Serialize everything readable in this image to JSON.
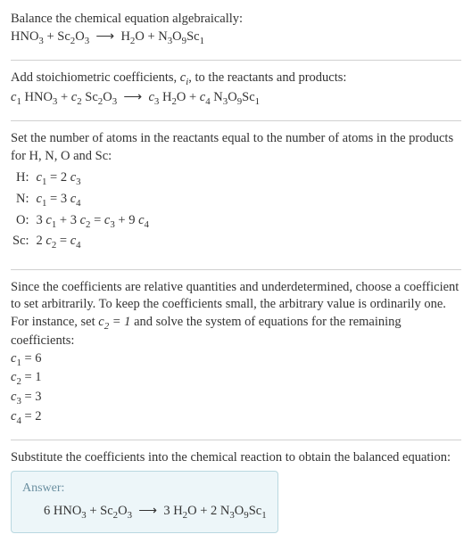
{
  "header": {
    "line1": "Balance the chemical equation algebraically:",
    "chem_eq": "HNO₃ + Sc₂O₃ ⟶ H₂O + N₃O₉Sc₁"
  },
  "step1": {
    "intro_a": "Add stoichiometric coefficients, ",
    "intro_ci": "cᵢ",
    "intro_b": ", to the reactants and products:",
    "chem_eq_a": "c₁ HNO₃ + c₂ Sc₂O₃ ⟶ c₃ H₂O + c₄ N₃O₉Sc₁"
  },
  "step2": {
    "intro": "Set the number of atoms in the reactants equal to the number of atoms in the products for H, N, O and Sc:",
    "rows": [
      {
        "lab": "H:",
        "eq": "c₁ = 2 c₃"
      },
      {
        "lab": "N:",
        "eq": "c₁ = 3 c₄"
      },
      {
        "lab": "O:",
        "eq": "3 c₁ + 3 c₂ = c₃ + 9 c₄"
      },
      {
        "lab": "Sc:",
        "eq": "2 c₂ = c₄"
      }
    ]
  },
  "step3": {
    "intro_a": "Since the coefficients are relative quantities and underdetermined, choose a coefficient to set arbitrarily. To keep the coefficients small, the arbitrary value is ordinarily one. For instance, set ",
    "intro_c2": "c₂ = 1",
    "intro_b": " and solve the system of equations for the remaining coefficients:",
    "sol": [
      "c₁ = 6",
      "c₂ = 1",
      "c₃ = 3",
      "c₄ = 2"
    ]
  },
  "step4": {
    "intro": "Substitute the coefficients into the chemical reaction to obtain the balanced equation:"
  },
  "answer": {
    "title": "Answer:",
    "line": "6 HNO₃ + Sc₂O₃ ⟶ 3 H₂O + 2 N₃O₉Sc₁"
  },
  "chart_data": {
    "type": "table",
    "title": "Balancing HNO3 + Sc2O3 → H2O + N3O9Sc1",
    "unbalanced_equation": "HNO3 + Sc2O3 → H2O + N3O9Sc1",
    "element_equations": [
      {
        "element": "H",
        "equation": "c1 = 2 c3"
      },
      {
        "element": "N",
        "equation": "c1 = 3 c4"
      },
      {
        "element": "O",
        "equation": "3 c1 + 3 c2 = c3 + 9 c4"
      },
      {
        "element": "Sc",
        "equation": "2 c2 = c4"
      }
    ],
    "arbitrary_set": "c2 = 1",
    "solution": {
      "c1": 6,
      "c2": 1,
      "c3": 3,
      "c4": 2
    },
    "balanced_equation": "6 HNO3 + Sc2O3 → 3 H2O + 2 N3O9Sc1"
  }
}
